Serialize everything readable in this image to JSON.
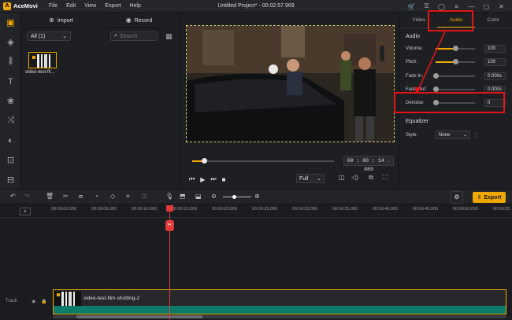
{
  "app": {
    "name": "AceMovi",
    "title": "Untitled Project* - 00:02:57.969",
    "menu": [
      "File",
      "Edit",
      "View",
      "Export",
      "Help"
    ]
  },
  "media": {
    "import_label": "Import",
    "record_label": "Record",
    "filter_value": "All (1)",
    "search_placeholder": "Search",
    "item_label": "video-test-fil..."
  },
  "preview": {
    "timecode": "00 : 00 : 14 . 889",
    "progress_fraction": 0.085,
    "quality": "Full"
  },
  "props": {
    "tabs": [
      "Video",
      "Audio",
      "Color"
    ],
    "active_tab": "Audio",
    "audio_section": "Audio",
    "rows": [
      {
        "label": "Volume:",
        "value": "100",
        "level": 0.5
      },
      {
        "label": "Pitch:",
        "value": "100",
        "level": 0.5
      },
      {
        "label": "Fade In:",
        "value": "0.000s",
        "level": 0
      },
      {
        "label": "Fade Out:",
        "value": "0.000s",
        "level": 0
      },
      {
        "label": "Denoise:",
        "value": "0",
        "level": 0
      }
    ],
    "equalizer_section": "Equalizer",
    "style_label": "Style:",
    "style_value": "None"
  },
  "toolbar": {
    "export_label": "Export"
  },
  "timeline": {
    "ticks": [
      "00:00:00.000",
      "00:00:05.000",
      "00:00:10.000",
      "00:00:15.000",
      "00:00:20.000",
      "00:00:25.000",
      "00:00:30.000",
      "00:00:35.000",
      "00:00:40.000",
      "00:00:45.000",
      "00:00:50.000",
      "00:00:55"
    ],
    "track_label": "Track",
    "clip_name": "video-test-film-shotting-2"
  },
  "colors": {
    "accent": "#f0a800",
    "annotation": "#e51414",
    "playhead": "#e23a3a",
    "audio_wave": "#0e7a6a"
  }
}
